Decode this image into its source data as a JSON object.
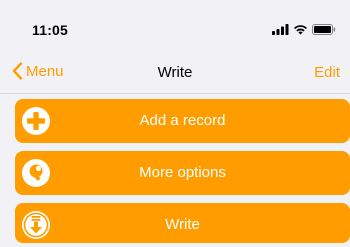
{
  "status": {
    "time": "11:05",
    "icons": [
      "cellular-signal-icon",
      "wifi-icon",
      "battery-icon"
    ]
  },
  "nav": {
    "back_label": "Menu",
    "title": "Write",
    "edit_label": "Edit"
  },
  "actions": [
    {
      "label": "Add a record",
      "icon": "plus-circle-icon"
    },
    {
      "label": "More options",
      "icon": "wrench-circle-icon"
    },
    {
      "label": "Write",
      "icon": "write-download-icon"
    }
  ],
  "colors": {
    "accent": "#ff9d00",
    "background": "#f2f2f6",
    "text_on_accent": "#ffffff"
  }
}
